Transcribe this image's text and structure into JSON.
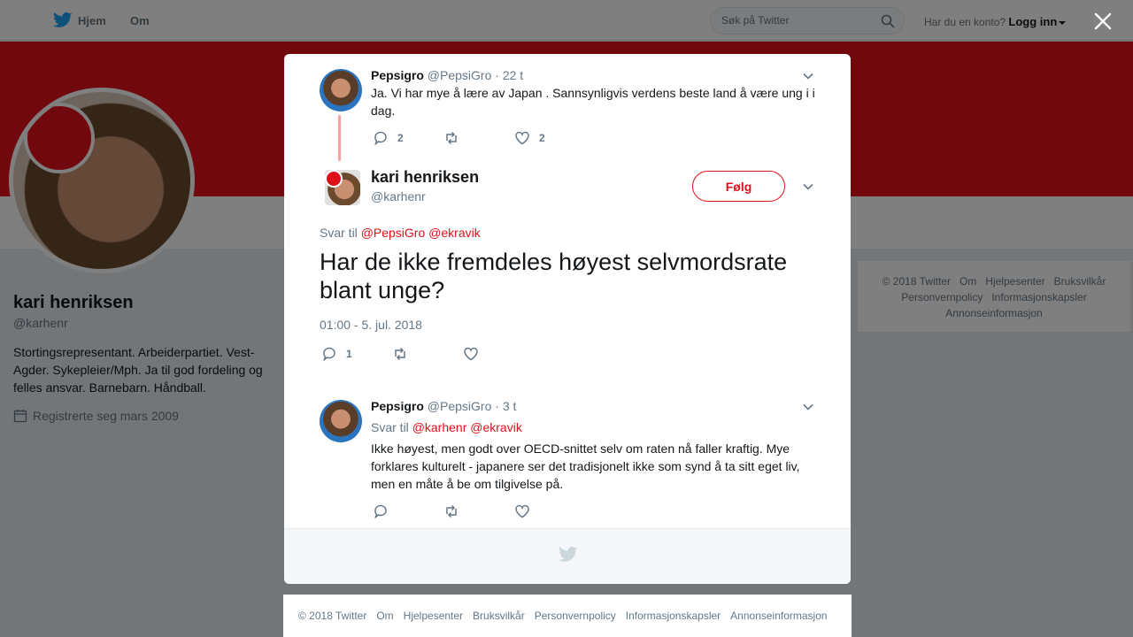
{
  "nav": {
    "home": "Hjem",
    "about": "Om",
    "search_placeholder": "Søk på Twitter",
    "account_prompt": "Har du en konto?",
    "login": "Logg inn"
  },
  "profile": {
    "name": "kari henriksen",
    "handle": "@karhenr",
    "bio": "Stortingsrepresentant. Arbeiderpartiet. Vest-Agder. Sykepleier/Mph. Ja til god fordeling og felles ansvar. Barnebarn. Håndball.",
    "joined": "Registrerte seg mars 2009"
  },
  "side_footer": [
    "© 2018 Twitter",
    "Om",
    "Hjelpesenter",
    "Bruksvilkår",
    "Personvernpolicy",
    "Informasjonskapsler",
    "Annonseinformasjon"
  ],
  "thread": {
    "parent": {
      "name": "Pepsigro",
      "handle": "@PepsiGro",
      "time": "· 22 t",
      "text": "Ja. Vi har mye å lære av Japan . Sannsynligvis verdens beste land å være ung i i dag.",
      "replies": "2",
      "retweets": "",
      "likes": "2"
    },
    "main": {
      "name": "kari henriksen",
      "handle": "@karhenr",
      "follow": "Følg",
      "reply_prefix": "Svar til",
      "reply_to_1": "@PepsiGro",
      "reply_to_2": "@ekravik",
      "text": "Har de ikke fremdeles høyest selvmordsrate blant unge?",
      "timestamp": "01:00 - 5. jul. 2018",
      "replies": "1",
      "retweets": "",
      "likes": ""
    },
    "reply": {
      "name": "Pepsigro",
      "handle": "@PepsiGro",
      "time": "· 3 t",
      "reply_prefix": "Svar til",
      "reply_to_1": "@karhenr",
      "reply_to_2": "@ekravik",
      "text": "Ikke høyest, men godt over OECD-snittet selv om raten nå faller kraftig. Mye forklares kulturelt - japanere ser det tradisjonelt ikke som synd å ta sitt eget liv, men en måte å be om tilgivelse på.",
      "replies": "",
      "retweets": "",
      "likes": ""
    }
  },
  "bottom_footer": [
    "© 2018 Twitter",
    "Om",
    "Hjelpesenter",
    "Bruksvilkår",
    "Personvernpolicy",
    "Informasjonskapsler",
    "Annonseinformasjon"
  ],
  "colors": {
    "accent": "#e0101a",
    "brand_blue": "#1da1f2",
    "muted": "#657786"
  }
}
